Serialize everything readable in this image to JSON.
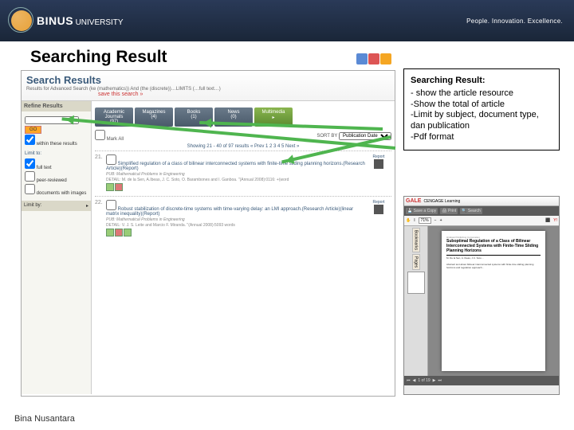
{
  "header": {
    "brand_bold": "BINUS",
    "brand_light": "UNIVERSITY",
    "tagline": "People. Innovation. Excellence."
  },
  "slide_title": "Searching Result",
  "footer": "Bina Nusantara",
  "annot": {
    "title": "Searching Result:",
    "l1": "- show the article resource",
    "l2": "-Show the total of article",
    "l3": "-Limit by subject, document type, dan publication",
    "l4": "-Pdf format"
  },
  "sr": {
    "heading": "Search Results",
    "query": "Results for Advanced Search (ke (mathematics)) And (the (discrete))…LIMITS (…full text…)",
    "save": "save this search »",
    "refine": {
      "title": "Refine Results",
      "go": "GO",
      "within": "within these results",
      "limit_to": "Limit to:",
      "cb_fulltext": "full text",
      "cb_peer": "peer-reviewed",
      "cb_img": "documents with images",
      "limit_by": "Limit by:"
    },
    "tabs": [
      {
        "l1": "Academic",
        "l2": "Journals",
        "n": "(97)"
      },
      {
        "l1": "Magazines",
        "l2": "",
        "n": "(4)"
      },
      {
        "l1": "Books",
        "l2": "",
        "n": "(1)"
      },
      {
        "l1": "News",
        "l2": "",
        "n": "(0)"
      },
      {
        "l1": "Multimedia",
        "l2": "",
        "n": ""
      }
    ],
    "markall": "Mark All",
    "sort_label": "SORT BY",
    "sort_value": "Publication Date",
    "pager": "Showing 21 - 40 of 97 results  « Prev 1 2 3 4 5  Next »",
    "res1": {
      "n": "21.",
      "title": "Simplified regulation of a class of bilinear interconnected systems with finite-time sliding planning horizons.(Research Article)(Report)",
      "pub": "PUB:  Mathematical Problems in Engineering",
      "det": "DETAIL: M. de la Sen, A.Ibeas, J. C. Soto, O. Barambones and I. Ganboa. \"(Annual 2008):0116: +(word",
      "report": "Report"
    },
    "res2": {
      "n": "22.",
      "title": "Robust stabilization of discrete-time systems with time-varying delay: an LMI approach.(Research Article)(linear matrix inequality)(Report)",
      "pub": "PUB:  Mathematical Problems in Engineering",
      "det": "DETAIL: V. J. S. Leite and Marcio F. Miranda. \"(Annual 2008):5093 words",
      "report": "Report"
    }
  },
  "pdf": {
    "brand": "GALE",
    "brand2": "CENGAGE Learning",
    "tool_save": "Save a Copy",
    "tool_print": "Print",
    "tool_search": "Search",
    "zoom": "71%",
    "side_tab1": "Bookmarks",
    "side_tab2": "Pages",
    "doc_title": "Suboptimal Regulation of a Class of Bilinear Interconnected Systems with Finite-Time Sliding Planning Horizons",
    "page_of": "1 of 19"
  }
}
